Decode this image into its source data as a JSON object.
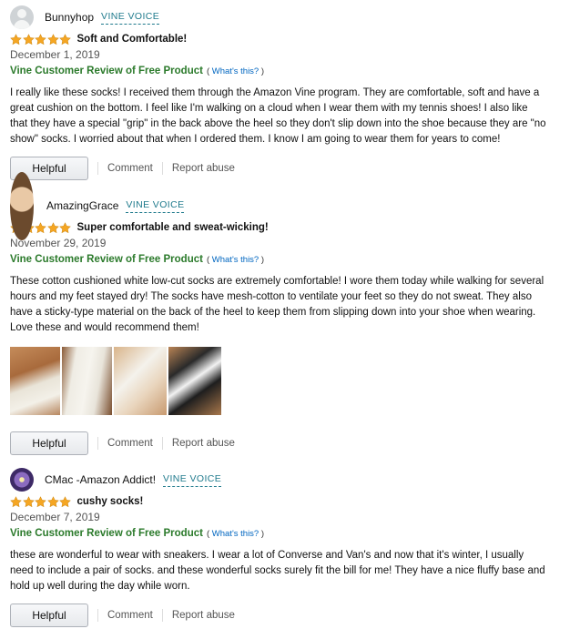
{
  "reviews": [
    {
      "author": "Bunnyhop",
      "avatar": "default-avatar-icon",
      "badge": "VINE VOICE",
      "rating": 5,
      "title": "Soft and Comfortable!",
      "date": "December 1, 2019",
      "vine_label": "Vine Customer Review of Free Product",
      "whats_this_open": "(",
      "whats_this": "What's this?",
      "whats_this_close": ")",
      "body": "I really like these socks! I received them through the Amazon Vine program. They are comfortable, soft and have a great cushion on the bottom. I feel like I'm walking on a cloud when I wear them with my tennis shoes! I also like that they have a special \"grip\" in the back above the heel so they don't slip down into the shoe because they are \"no show\" socks. I worried about that when I ordered them. I know I am going to wear them for years to come!",
      "helpful_label": "Helpful",
      "comment_label": "Comment",
      "report_label": "Report abuse"
    },
    {
      "author": "AmazingGrace",
      "avatar": "user-photo-avatar",
      "badge": "VINE VOICE",
      "rating": 5,
      "title": "Super comfortable and sweat-wicking!",
      "date": "November 29, 2019",
      "vine_label": "Vine Customer Review of Free Product",
      "whats_this_open": "(",
      "whats_this": "What's this?",
      "whats_this_close": ")",
      "body": "These cotton cushioned white low-cut socks are extremely comfortable! I wore them today while walking for several hours and my feet stayed dry! The socks have mesh-cotton to ventilate your feet so they do not sweat. They also have a sticky-type material on the back of the heel to keep them from slipping down into your shoe when wearing. Love these and would recommend them!",
      "photo_count": 4,
      "helpful_label": "Helpful",
      "comment_label": "Comment",
      "report_label": "Report abuse"
    },
    {
      "author": "CMac -Amazon Addict!",
      "avatar": "flower-avatar",
      "badge": "VINE VOICE",
      "rating": 5,
      "title": "cushy socks!",
      "date": "December 7, 2019",
      "vine_label": "Vine Customer Review of Free Product",
      "whats_this_open": "(",
      "whats_this": "What's this?",
      "whats_this_close": ")",
      "body": "these are wonderful to wear with sneakers. I wear a lot of Converse and Van's and now that it's winter, I usually need to include a pair of socks. and these wonderful socks surely fit the bill for me! They have a nice fluffy base and hold up well during the day while worn.",
      "helpful_label": "Helpful",
      "comment_label": "Comment",
      "report_label": "Report abuse"
    }
  ],
  "colors": {
    "star": "#f5a623",
    "vine_green": "#2b7a2b",
    "badge_teal": "#1f7a8c",
    "link_blue": "#0066c0"
  }
}
